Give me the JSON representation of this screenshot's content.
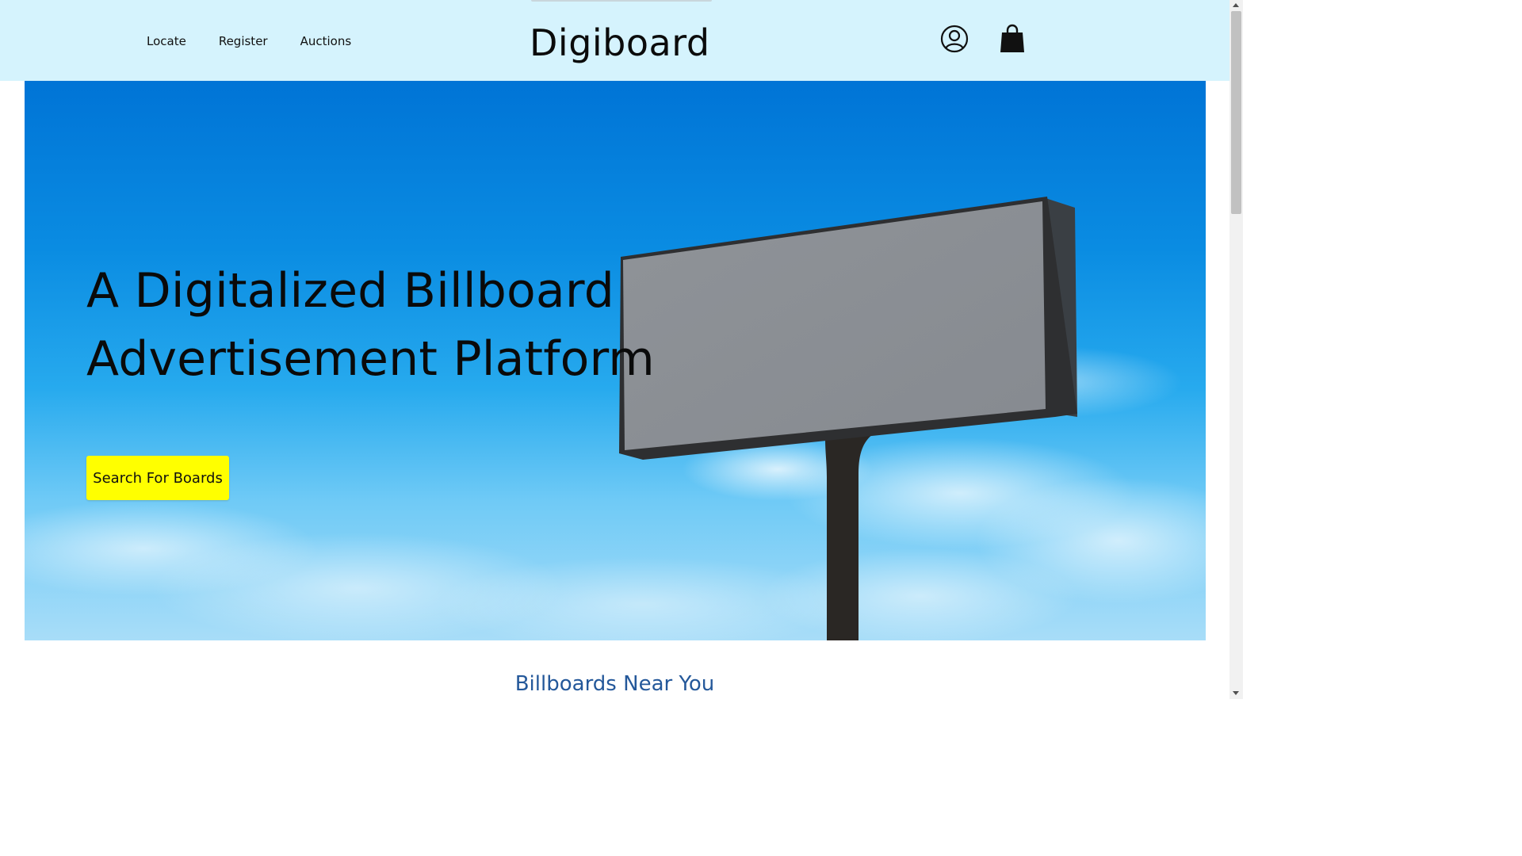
{
  "header": {
    "brand": "Digiboard",
    "nav": [
      {
        "label": "Locate"
      },
      {
        "label": "Register"
      },
      {
        "label": "Auctions"
      }
    ],
    "icons": {
      "account": "user-circle-icon",
      "cart": "shopping-bag-icon"
    }
  },
  "hero": {
    "title_line1": "A Digitalized Billboard",
    "title_line2": "Advertisement Platform",
    "cta_label": "Search For Boards",
    "cta_color": "#ffff00"
  },
  "section": {
    "title": "Billboards Near You"
  },
  "colors": {
    "header_bg": "#d5f3fd",
    "section_title": "#24589a"
  }
}
